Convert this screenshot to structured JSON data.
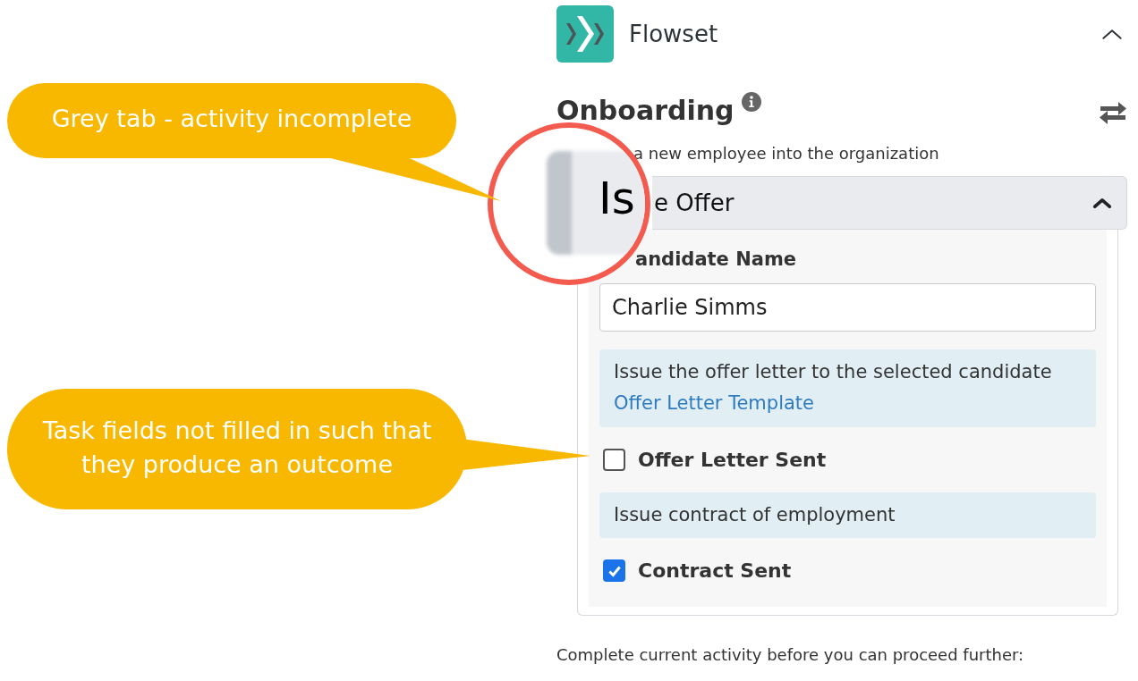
{
  "app": {
    "name": "Flowset",
    "expanded": true
  },
  "process": {
    "title": "Onboarding",
    "description": "a new employee into the organization"
  },
  "activity": {
    "title": "e Offer",
    "expanded": true,
    "fields": [
      {
        "kind": "text",
        "label": "andidate Name",
        "value": "Charlie Simms"
      },
      {
        "kind": "info",
        "text": "Issue the offer letter to the selected candidate",
        "link": "Offer Letter Template"
      },
      {
        "kind": "checkbox",
        "label": "Offer Letter Sent",
        "checked": false
      },
      {
        "kind": "info",
        "text": "Issue contract of employment"
      },
      {
        "kind": "checkbox",
        "label": "Contract Sent",
        "checked": true
      }
    ]
  },
  "footer": "Complete current activity before you can proceed further:",
  "annotations": {
    "magnifier": {
      "text": "Is"
    },
    "callouts": [
      {
        "text": "Grey tab - activity incomplete"
      },
      {
        "text": "Task fields not filled in such that they produce an outcome"
      }
    ]
  }
}
